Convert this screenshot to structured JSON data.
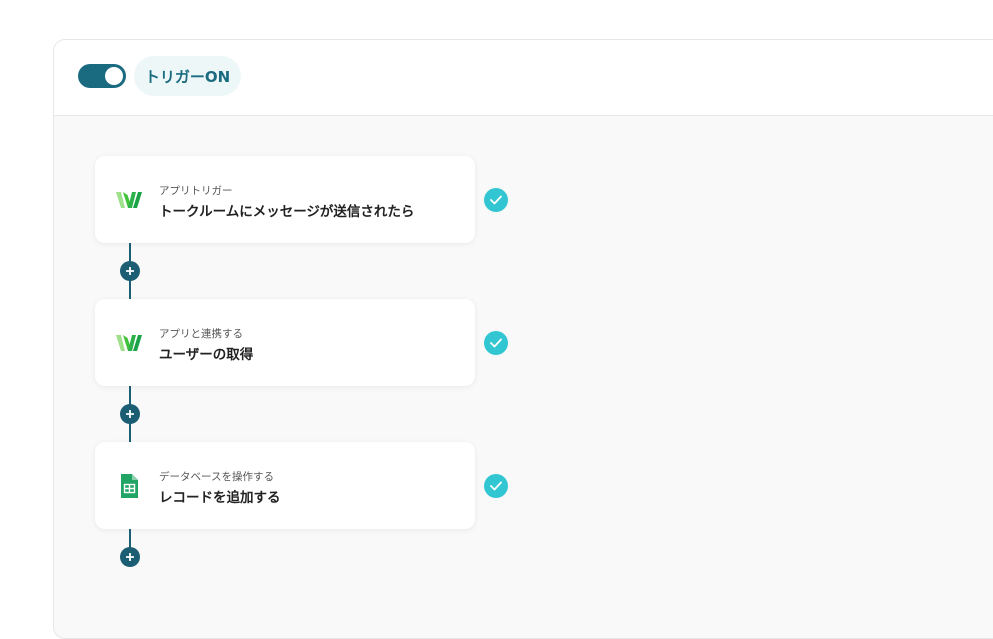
{
  "header": {
    "trigger_label": "トリガーON",
    "toggle_on": true
  },
  "flow": {
    "steps": [
      {
        "category": "アプリトリガー",
        "title": "トークルームにメッセージが送信されたら",
        "icon": "line-works-icon",
        "status": "complete"
      },
      {
        "category": "アプリと連携する",
        "title": "ユーザーの取得",
        "icon": "line-works-icon",
        "status": "complete"
      },
      {
        "category": "データベースを操作する",
        "title": "レコードを追加する",
        "icon": "google-sheets-icon",
        "status": "complete"
      }
    ]
  },
  "colors": {
    "accent": "#1b6b80",
    "check": "#32c5d2",
    "connector": "#1b5e73"
  }
}
